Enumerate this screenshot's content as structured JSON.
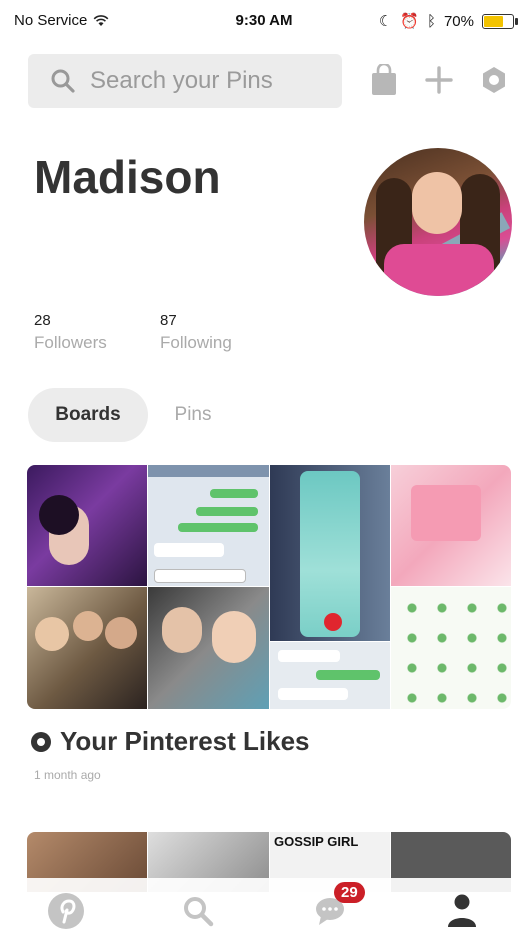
{
  "status": {
    "carrier": "No Service",
    "time": "9:30 AM",
    "battery_pct": 70,
    "battery_text": "70%"
  },
  "search": {
    "placeholder": "Search your Pins"
  },
  "profile": {
    "name": "Madison",
    "followers_count": "28",
    "followers_label": "Followers",
    "following_count": "87",
    "following_label": "Following"
  },
  "tabs": [
    {
      "label": "Boards",
      "active": true
    },
    {
      "label": "Pins",
      "active": false
    }
  ],
  "boards": [
    {
      "title": "Your Pinterest Likes",
      "time": "1 month ago"
    }
  ],
  "board2_text": "GOSSIP GIRL",
  "nav": {
    "messages_badge": "29"
  },
  "colors": {
    "accent": "#cb1f27",
    "tab_bg": "#ececec",
    "muted": "#aaaaaa",
    "battery": "#f3c300"
  }
}
